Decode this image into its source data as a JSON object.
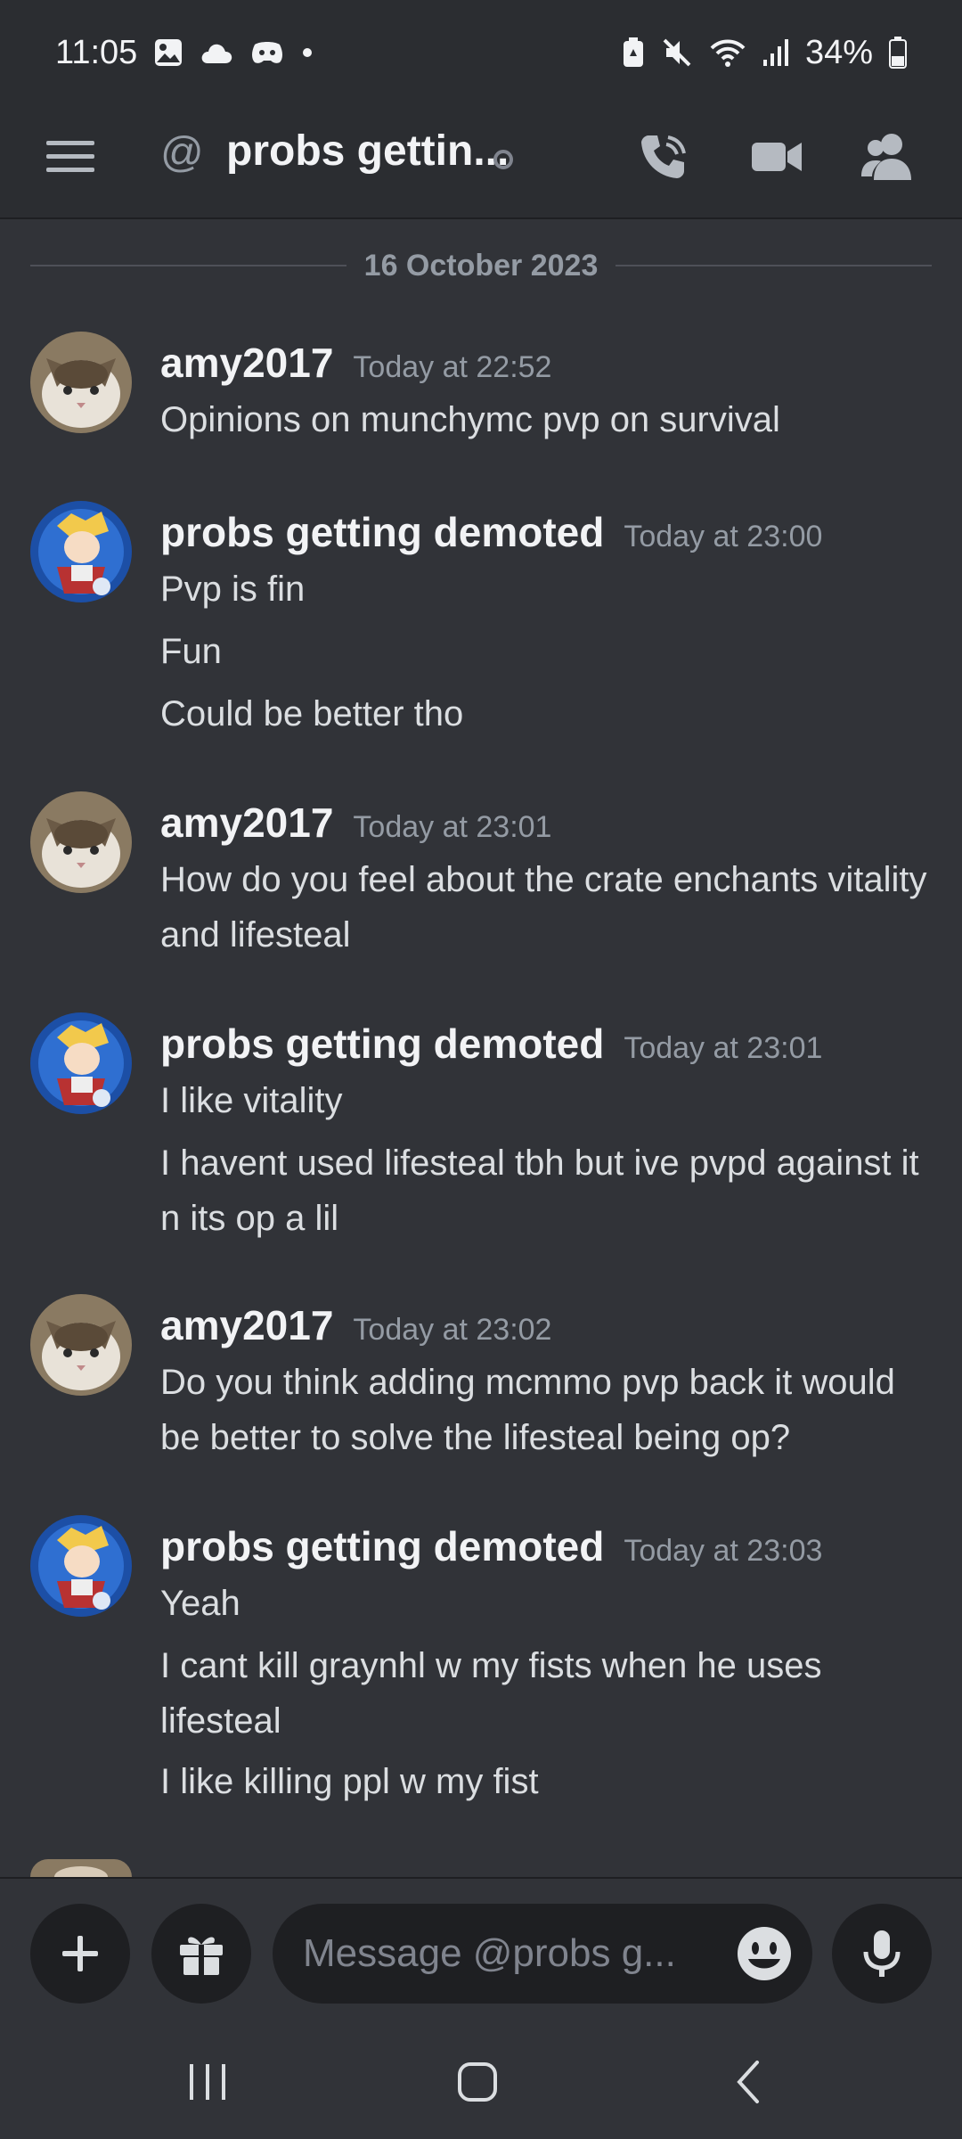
{
  "status_bar": {
    "time": "11:05",
    "battery": "34%"
  },
  "header": {
    "at_symbol": "@",
    "title": "probs gettin..."
  },
  "date_divider": "16 October 2023",
  "messages": [
    {
      "username": "amy2017",
      "timestamp": "Today at 22:52",
      "lines": [
        "Opinions on munchymc pvp on survival"
      ]
    },
    {
      "username": "probs getting demoted",
      "timestamp": "Today at 23:00",
      "lines": [
        "Pvp is fin",
        "Fun",
        "Could be better tho"
      ]
    },
    {
      "username": "amy2017",
      "timestamp": "Today at 23:01",
      "lines": [
        "How do you feel about the crate enchants vitality and lifesteal"
      ]
    },
    {
      "username": "probs getting demoted",
      "timestamp": "Today at 23:01",
      "lines": [
        "I like vitality",
        "I havent used lifesteal tbh but ive pvpd against it n its op a lil"
      ]
    },
    {
      "username": "amy2017",
      "timestamp": "Today at 23:02",
      "lines": [
        "Do you think adding mcmmo pvp back it would be better to solve the lifesteal being op?"
      ]
    },
    {
      "username": "probs getting demoted",
      "timestamp": "Today at 23:03",
      "lines": [
        "Yeah",
        "I cant kill graynhl w my fists when he uses lifesteal",
        "I like killing ppl w my fist"
      ]
    }
  ],
  "composer": {
    "placeholder": "Message @probs g..."
  },
  "colors": {
    "background": "#313338",
    "header": "#2b2d31",
    "input": "#1e1f22",
    "muted_text": "#949ba4"
  }
}
